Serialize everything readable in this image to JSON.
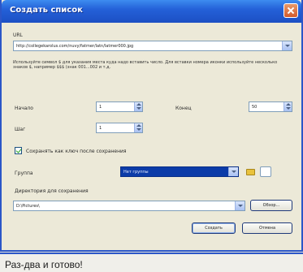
{
  "window": {
    "title": "Создать список"
  },
  "url": {
    "label": "URL",
    "value": "http://collegekarolus.com/nuvy/fatmer/latn/latmer000.jpg"
  },
  "help_text": "Используйте символ $ для указания места куда надо вставить число. Для вставки номера иконки используйте несколько знаков $, например $$$ (знак 001...002 и т.д.",
  "start": {
    "label": "Начало",
    "value": "1"
  },
  "end": {
    "label": "Конец",
    "value": "50"
  },
  "step": {
    "label": "Шаг",
    "value": "1"
  },
  "save_by_pattern": {
    "label": "Сохранять как ключ после сохранения",
    "checked": true
  },
  "group": {
    "label": "Группа",
    "value": "Нет группы"
  },
  "save_dir": {
    "label": "Директория для сохранения",
    "value": "D:\\Pictures\\",
    "browse_label": "Обзор..."
  },
  "buttons": {
    "create": "Создать",
    "cancel": "Отмена"
  },
  "caption": "Раз-два и готово!"
}
